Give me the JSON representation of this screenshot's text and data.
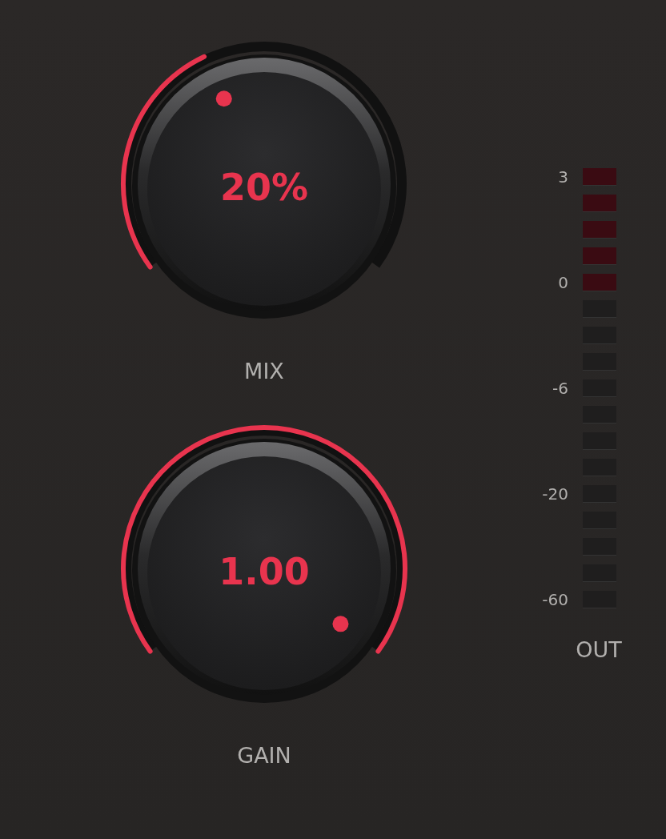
{
  "knobs": [
    {
      "label": "MIX",
      "value": "20%"
    },
    {
      "label": "GAIN",
      "value": "1.00"
    }
  ],
  "meter": {
    "label": "OUT",
    "scale": [
      "3",
      "0",
      "-6",
      "-20",
      "-60"
    ]
  }
}
